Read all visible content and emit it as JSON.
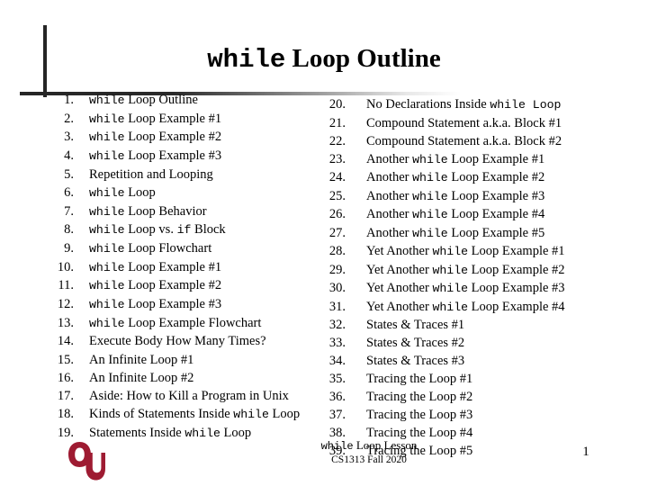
{
  "slide": {
    "title": {
      "mono_part": "while",
      "serif_part": "Loop Outline",
      "full": "while Loop Outline"
    },
    "page_number": "1",
    "footer": {
      "lesson_mono": "while",
      "lesson_rest": "Loop Lesson",
      "course": "CS1313 Fall 2020"
    },
    "logo": {
      "alt": "University of Oklahoma OU logo",
      "color": "#9e1b32"
    },
    "accent_color": "#262626",
    "outline_left": [
      {
        "num": "1.",
        "parts": [
          {
            "t": "while",
            "m": true
          },
          {
            "t": " Loop Outline",
            "m": false
          }
        ]
      },
      {
        "num": "2.",
        "parts": [
          {
            "t": "while",
            "m": true
          },
          {
            "t": " Loop Example #1",
            "m": false
          }
        ]
      },
      {
        "num": "3.",
        "parts": [
          {
            "t": "while",
            "m": true
          },
          {
            "t": " Loop Example #2",
            "m": false
          }
        ]
      },
      {
        "num": "4.",
        "parts": [
          {
            "t": "while",
            "m": true
          },
          {
            "t": " Loop Example #3",
            "m": false
          }
        ]
      },
      {
        "num": "5.",
        "parts": [
          {
            "t": "Repetition and Looping",
            "m": false
          }
        ]
      },
      {
        "num": "6.",
        "parts": [
          {
            "t": "while",
            "m": true
          },
          {
            "t": " Loop",
            "m": false
          }
        ]
      },
      {
        "num": "7.",
        "parts": [
          {
            "t": "while",
            "m": true
          },
          {
            "t": " Loop Behavior",
            "m": false
          }
        ]
      },
      {
        "num": "8.",
        "parts": [
          {
            "t": "while",
            "m": true
          },
          {
            "t": " Loop vs. ",
            "m": false
          },
          {
            "t": "if",
            "m": true
          },
          {
            "t": " Block",
            "m": false
          }
        ]
      },
      {
        "num": "9.",
        "parts": [
          {
            "t": "while",
            "m": true
          },
          {
            "t": " Loop Flowchart",
            "m": false
          }
        ]
      },
      {
        "num": "10.",
        "parts": [
          {
            "t": "while",
            "m": true
          },
          {
            "t": " Loop Example #1",
            "m": false
          }
        ]
      },
      {
        "num": "11.",
        "parts": [
          {
            "t": "while",
            "m": true
          },
          {
            "t": " Loop Example #2",
            "m": false
          }
        ]
      },
      {
        "num": "12.",
        "parts": [
          {
            "t": "while",
            "m": true
          },
          {
            "t": " Loop Example #3",
            "m": false
          }
        ]
      },
      {
        "num": "13.",
        "parts": [
          {
            "t": "while",
            "m": true
          },
          {
            "t": " Loop Example Flowchart",
            "m": false
          }
        ]
      },
      {
        "num": "14.",
        "parts": [
          {
            "t": "Execute Body How Many Times?",
            "m": false
          }
        ]
      },
      {
        "num": "15.",
        "parts": [
          {
            "t": "An Infinite Loop #1",
            "m": false
          }
        ]
      },
      {
        "num": "16.",
        "parts": [
          {
            "t": "An Infinite Loop #2",
            "m": false
          }
        ]
      },
      {
        "num": "17.",
        "parts": [
          {
            "t": "Aside: How to Kill a Program in Unix",
            "m": false
          }
        ]
      },
      {
        "num": "18.",
        "parts": [
          {
            "t": "Kinds of Statements Inside ",
            "m": false
          },
          {
            "t": "while",
            "m": true
          },
          {
            "t": " Loop",
            "m": false
          }
        ]
      },
      {
        "num": "19.",
        "parts": [
          {
            "t": "Statements Inside ",
            "m": false
          },
          {
            "t": "while",
            "m": true
          },
          {
            "t": " Loop",
            "m": false
          }
        ]
      }
    ],
    "outline_right": [
      {
        "num": "20.",
        "parts": [
          {
            "t": "No Declarations Inside ",
            "m": false
          },
          {
            "t": "while Loop",
            "m": true
          }
        ]
      },
      {
        "num": "21.",
        "parts": [
          {
            "t": "Compound Statement a.k.a. Block #1",
            "m": false
          }
        ]
      },
      {
        "num": "22.",
        "parts": [
          {
            "t": "Compound Statement a.k.a. Block #2",
            "m": false
          }
        ]
      },
      {
        "num": "23.",
        "parts": [
          {
            "t": "Another ",
            "m": false
          },
          {
            "t": "while",
            "m": true
          },
          {
            "t": " Loop Example #1",
            "m": false
          }
        ]
      },
      {
        "num": "24.",
        "parts": [
          {
            "t": "Another ",
            "m": false
          },
          {
            "t": "while",
            "m": true
          },
          {
            "t": " Loop Example #2",
            "m": false
          }
        ]
      },
      {
        "num": "25.",
        "parts": [
          {
            "t": "Another ",
            "m": false
          },
          {
            "t": "while",
            "m": true
          },
          {
            "t": " Loop Example #3",
            "m": false
          }
        ]
      },
      {
        "num": "26.",
        "parts": [
          {
            "t": "Another ",
            "m": false
          },
          {
            "t": "while",
            "m": true
          },
          {
            "t": " Loop Example #4",
            "m": false
          }
        ]
      },
      {
        "num": "27.",
        "parts": [
          {
            "t": "Another ",
            "m": false
          },
          {
            "t": "while",
            "m": true
          },
          {
            "t": " Loop Example #5",
            "m": false
          }
        ]
      },
      {
        "num": "28.",
        "parts": [
          {
            "t": "Yet Another ",
            "m": false
          },
          {
            "t": "while",
            "m": true
          },
          {
            "t": " Loop Example #1",
            "m": false
          }
        ]
      },
      {
        "num": "29.",
        "parts": [
          {
            "t": "Yet Another ",
            "m": false
          },
          {
            "t": "while",
            "m": true
          },
          {
            "t": " Loop Example #2",
            "m": false
          }
        ]
      },
      {
        "num": "30.",
        "parts": [
          {
            "t": "Yet Another ",
            "m": false
          },
          {
            "t": "while",
            "m": true
          },
          {
            "t": " Loop Example #3",
            "m": false
          }
        ]
      },
      {
        "num": "31.",
        "parts": [
          {
            "t": "Yet Another ",
            "m": false
          },
          {
            "t": "while",
            "m": true
          },
          {
            "t": " Loop Example #4",
            "m": false
          }
        ]
      },
      {
        "num": "32.",
        "parts": [
          {
            "t": "States & Traces #1",
            "m": false
          }
        ]
      },
      {
        "num": "33.",
        "parts": [
          {
            "t": "States & Traces #2",
            "m": false
          }
        ]
      },
      {
        "num": "34.",
        "parts": [
          {
            "t": "States & Traces #3",
            "m": false
          }
        ]
      },
      {
        "num": "35.",
        "parts": [
          {
            "t": "Tracing the Loop #1",
            "m": false
          }
        ]
      },
      {
        "num": "36.",
        "parts": [
          {
            "t": "Tracing the Loop #2",
            "m": false
          }
        ]
      },
      {
        "num": "37.",
        "parts": [
          {
            "t": "Tracing the Loop #3",
            "m": false
          }
        ]
      },
      {
        "num": "38.",
        "parts": [
          {
            "t": "Tracing the Loop #4",
            "m": false
          }
        ]
      },
      {
        "num": "39.",
        "parts": [
          {
            "t": "Tracing the Loop #5",
            "m": false
          }
        ]
      }
    ]
  }
}
